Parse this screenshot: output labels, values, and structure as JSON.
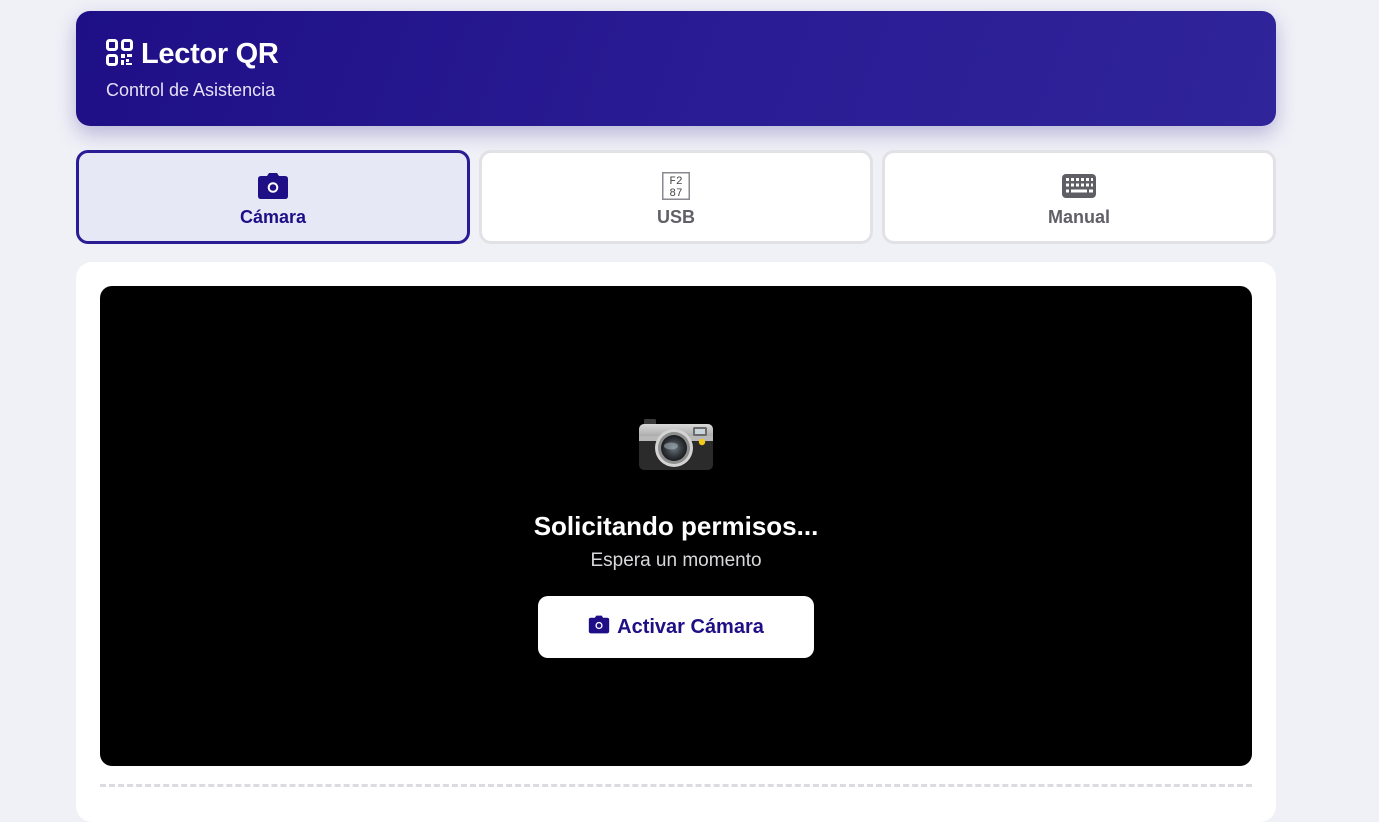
{
  "header": {
    "title": "Lector QR",
    "subtitle": "Control de Asistencia",
    "icon": "qrcode-icon"
  },
  "tabs": [
    {
      "label": "Cámara",
      "icon": "camera-icon",
      "active": true
    },
    {
      "label": "USB",
      "icon": "barcode-icon",
      "active": false
    },
    {
      "label": "Manual",
      "icon": "keyboard-icon",
      "active": false
    }
  ],
  "camera": {
    "emoji": "camera-with-flash-icon",
    "status_title": "Solicitando permisos...",
    "status_subtitle": "Espera un momento",
    "activate_button": "Activar Cámara"
  },
  "colors": {
    "brand": "#1e0f86",
    "background": "#f0f1f7",
    "active_tab_bg": "#e7e8f6"
  }
}
